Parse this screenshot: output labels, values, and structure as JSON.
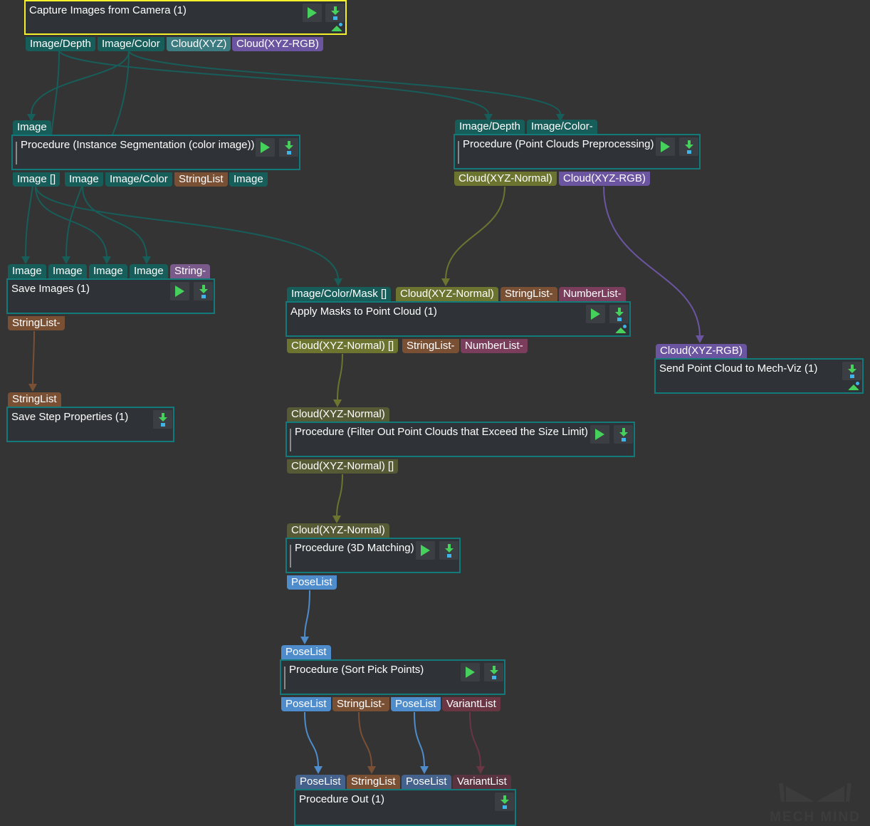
{
  "colors": {
    "background": "#343434",
    "node_border": "#127a7a",
    "selected_border": "#f4f02c",
    "image": "#175e5a",
    "cloud_xyz": "#3c7c80",
    "cloud_rgb": "#6c55a0",
    "cloud_normal": "#6c7430",
    "string_list": "#7a5035",
    "number_list": "#7a3d5c",
    "pose_list": "#4f8ccc",
    "variant_list": "#6a3644",
    "play_green": "#45d15b",
    "marker_blue": "#3fb4e8"
  },
  "nodes": {
    "capture": {
      "title": "Capture Images from Camera (1)",
      "outputs": [
        "Image/Depth",
        "Image/Color",
        "Cloud(XYZ)",
        "Cloud(XYZ-RGB)"
      ]
    },
    "instance_seg": {
      "inputs": [
        "Image"
      ],
      "title": "Procedure (Instance Segmentation (color image))",
      "outputs": [
        "Image []",
        "Image",
        "Image/Color",
        "StringList",
        "Image"
      ]
    },
    "pc_preproc": {
      "inputs": [
        "Image/Depth",
        "Image/Color-"
      ],
      "title": "Procedure (Point Clouds Preprocessing)",
      "outputs": [
        "Cloud(XYZ-Normal)",
        "Cloud(XYZ-RGB)"
      ]
    },
    "save_images": {
      "inputs": [
        "Image",
        "Image",
        "Image",
        "Image",
        "String-"
      ],
      "title": "Save Images (1)",
      "outputs": [
        "StringList-"
      ]
    },
    "apply_masks": {
      "inputs": [
        "Image/Color/Mask []",
        "Cloud(XYZ-Normal)",
        "StringList-",
        "NumberList-"
      ],
      "title": "Apply Masks to Point Cloud (1)",
      "outputs": [
        "Cloud(XYZ-Normal) []",
        "StringList-",
        "NumberList-"
      ]
    },
    "send_viz": {
      "inputs": [
        "Cloud(XYZ-RGB)"
      ],
      "title": "Send Point Cloud to Mech-Viz (1)"
    },
    "save_step": {
      "inputs": [
        "StringList"
      ],
      "title": "Save Step Properties (1)"
    },
    "filter": {
      "inputs": [
        "Cloud(XYZ-Normal)"
      ],
      "title": "Procedure (Filter Out Point Clouds that Exceed the Size Limit)",
      "outputs": [
        "Cloud(XYZ-Normal) []"
      ]
    },
    "matching": {
      "inputs": [
        "Cloud(XYZ-Normal)"
      ],
      "title": "Procedure (3D Matching)",
      "outputs": [
        "PoseList"
      ]
    },
    "sort": {
      "inputs": [
        "PoseList"
      ],
      "title": "Procedure (Sort Pick Points)",
      "outputs": [
        "PoseList",
        "StringList-",
        "PoseList",
        "VariantList"
      ]
    },
    "proc_out": {
      "inputs": [
        "PoseList",
        "StringList",
        "PoseList",
        "VariantList"
      ],
      "title": "Procedure Out (1)"
    }
  },
  "connections": [
    {
      "from": "capture.out.Image/Color",
      "to": "instance_seg.in.Image",
      "type": "image"
    },
    {
      "from": "capture.out.Image/Depth",
      "to": "pc_preproc.in.Image/Depth",
      "type": "image"
    },
    {
      "from": "capture.out.Image/Color",
      "to": "pc_preproc.in.Image/Color-",
      "type": "image"
    },
    {
      "from": "instance_seg.out.Image []",
      "to": "save_images.in.Image#1",
      "type": "image"
    },
    {
      "from": "instance_seg.out.Image",
      "to": "save_images.in.Image#2",
      "type": "image"
    },
    {
      "from": "instance_seg.out.Image []",
      "to": "save_images.in.Image#3",
      "type": "image"
    },
    {
      "from": "instance_seg.out.Image",
      "to": "save_images.in.Image#4",
      "type": "image"
    },
    {
      "from": "instance_seg.out.Image []",
      "to": "apply_masks.in.Image/Color/Mask []",
      "type": "image"
    },
    {
      "from": "pc_preproc.out.Cloud(XYZ-Normal)",
      "to": "apply_masks.in.Cloud(XYZ-Normal)",
      "type": "cloud_normal"
    },
    {
      "from": "pc_preproc.out.Cloud(XYZ-RGB)",
      "to": "send_viz.in.Cloud(XYZ-RGB)",
      "type": "cloud_rgb"
    },
    {
      "from": "save_images.out.StringList-",
      "to": "save_step.in.StringList",
      "type": "string_list"
    },
    {
      "from": "apply_masks.out.Cloud(XYZ-Normal) []",
      "to": "filter.in.Cloud(XYZ-Normal)",
      "type": "cloud_normal"
    },
    {
      "from": "filter.out.Cloud(XYZ-Normal) []",
      "to": "matching.in.Cloud(XYZ-Normal)",
      "type": "cloud_normal"
    },
    {
      "from": "matching.out.PoseList",
      "to": "sort.in.PoseList",
      "type": "pose_list"
    },
    {
      "from": "sort.out.PoseList#1",
      "to": "proc_out.in.PoseList#1",
      "type": "pose_list"
    },
    {
      "from": "sort.out.StringList-",
      "to": "proc_out.in.StringList",
      "type": "string_list"
    },
    {
      "from": "sort.out.PoseList#2",
      "to": "proc_out.in.PoseList#2",
      "type": "pose_list"
    },
    {
      "from": "sort.out.VariantList",
      "to": "proc_out.in.VariantList",
      "type": "variant_list"
    }
  ],
  "watermark": "MECH MIND"
}
